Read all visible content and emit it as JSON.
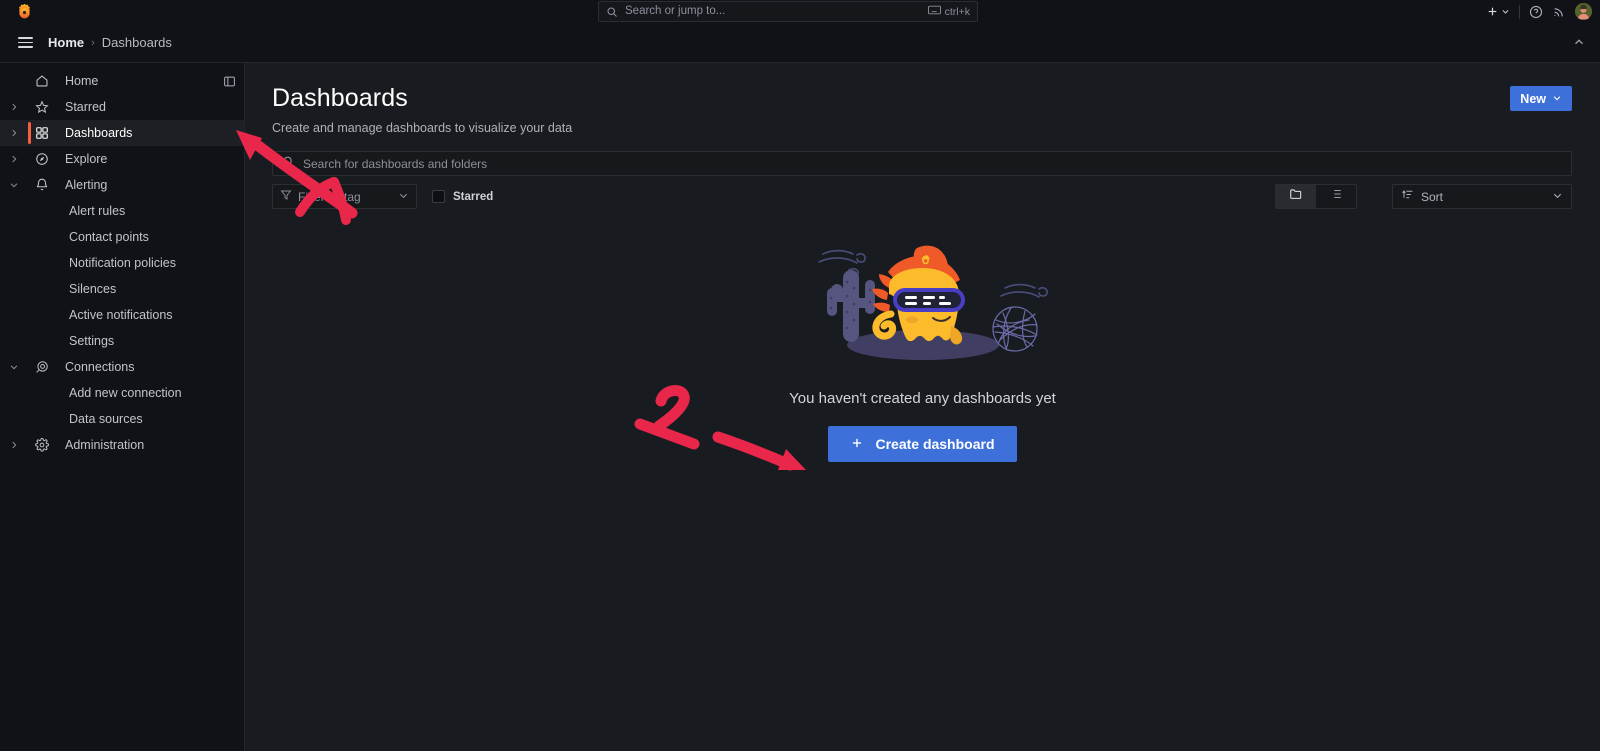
{
  "app": {
    "logo_icon": "grafana-logo-icon",
    "background": "#111217",
    "content_background": "#181b1f",
    "accent_blue": "#3d71d9",
    "accent_orange": "#f55f3e",
    "annotation_red": "#e8274a"
  },
  "topbar": {
    "search": {
      "placeholder": "Search or jump to...",
      "icon": "search-icon",
      "shortcut": "ctrl+k",
      "shortcut_icon": "keyboard-icon"
    },
    "actions": {
      "new_plus_label": "+",
      "plus_chevron_icon": "chevron-down-icon",
      "help_icon": "help-circle-icon",
      "news_icon": "rss-news-icon",
      "avatar_icon": "user-avatar"
    }
  },
  "breadcrumb": {
    "menu_icon": "hamburger-menu-icon",
    "home": "Home",
    "separator": "›",
    "current": "Dashboards",
    "collapse_icon": "chevron-up-icon"
  },
  "sidebar": {
    "dock_icon": "dock-panel-icon",
    "items": [
      {
        "label": "Home",
        "icon": "home-icon",
        "expandable": false,
        "active": false,
        "sub": []
      },
      {
        "label": "Starred",
        "icon": "star-icon",
        "expandable": true,
        "active": false,
        "sub": []
      },
      {
        "label": "Dashboards",
        "icon": "dashboards-grid-icon",
        "expandable": true,
        "active": true,
        "sub": []
      },
      {
        "label": "Explore",
        "icon": "compass-icon",
        "expandable": true,
        "active": false,
        "sub": []
      },
      {
        "label": "Alerting",
        "icon": "bell-icon",
        "expandable": true,
        "expanded": true,
        "active": false,
        "sub": [
          "Alert rules",
          "Contact points",
          "Notification policies",
          "Silences",
          "Active notifications",
          "Settings"
        ]
      },
      {
        "label": "Connections",
        "icon": "connections-icon",
        "expandable": true,
        "expanded": true,
        "active": false,
        "sub": [
          "Add new connection",
          "Data sources"
        ]
      },
      {
        "label": "Administration",
        "icon": "gear-icon",
        "expandable": true,
        "active": false,
        "sub": []
      }
    ]
  },
  "main": {
    "title": "Dashboards",
    "subtitle": "Create and manage dashboards to visualize your data",
    "new_button": {
      "label": "New",
      "chevron_icon": "chevron-down-icon"
    },
    "search": {
      "placeholder": "Search for dashboards and folders",
      "value": "",
      "icon": "search-icon"
    },
    "tag_filter": {
      "label": "Filter by tag",
      "icon": "tag-filter-icon",
      "chevron_icon": "chevron-down-icon"
    },
    "starred_filter": {
      "label": "Starred",
      "checked": false
    },
    "view_toggle": {
      "folder_view": {
        "icon": "folder-icon",
        "active": true
      },
      "list_view": {
        "icon": "list-icon",
        "active": false
      }
    },
    "sort": {
      "label": "Sort",
      "icon": "sort-ascending-icon",
      "chevron_icon": "chevron-down-icon"
    },
    "empty_state": {
      "illustration": "grafana-mascot-desert-illustration",
      "message": "You haven't created any dashboards yet",
      "button": {
        "label": "Create dashboard",
        "icon": "plus-icon"
      }
    }
  },
  "annotations": [
    {
      "name": "annotation-arrow-to-dashboards-nav",
      "type": "arrow",
      "label": "1"
    },
    {
      "name": "annotation-arrow-to-create-dashboard",
      "type": "arrow",
      "label": "2"
    }
  ]
}
